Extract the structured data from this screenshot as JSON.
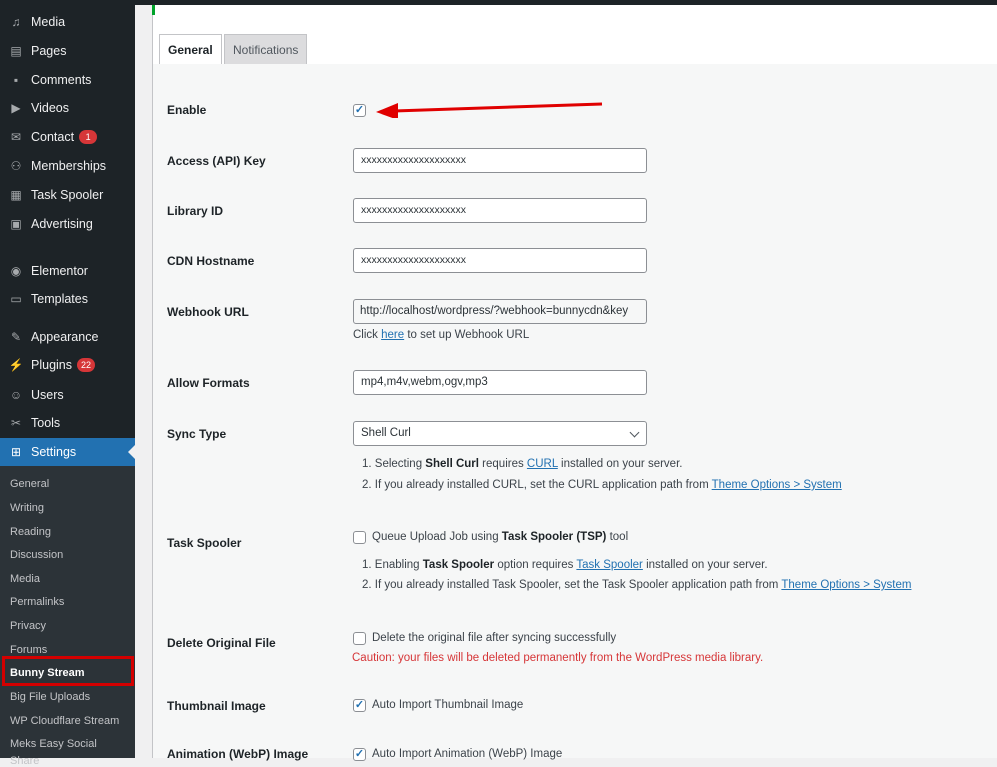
{
  "sidebar": {
    "menu": [
      {
        "label": "Media",
        "icon": "media-icon",
        "glyph": "♫"
      },
      {
        "label": "Pages",
        "icon": "pages-icon",
        "glyph": "▤"
      },
      {
        "label": "Comments",
        "icon": "comments-icon",
        "glyph": "▪"
      },
      {
        "label": "Videos",
        "icon": "videos-icon",
        "glyph": "▶"
      },
      {
        "label": "Contact",
        "icon": "contact-icon",
        "glyph": "✉",
        "badge": "1"
      },
      {
        "label": "Memberships",
        "icon": "memberships-icon",
        "glyph": "⚇"
      },
      {
        "label": "Task Spooler",
        "icon": "task-spooler-icon",
        "glyph": "▦"
      },
      {
        "label": "Advertising",
        "icon": "advertising-icon",
        "glyph": "▣"
      },
      {
        "label": "Elementor",
        "icon": "elementor-icon",
        "glyph": "◉"
      },
      {
        "label": "Templates",
        "icon": "templates-icon",
        "glyph": "▭"
      },
      {
        "label": "Appearance",
        "icon": "appearance-icon",
        "glyph": "✎"
      },
      {
        "label": "Plugins",
        "icon": "plugins-icon",
        "glyph": "⚡",
        "badge": "22"
      },
      {
        "label": "Users",
        "icon": "users-icon",
        "glyph": "☺"
      },
      {
        "label": "Tools",
        "icon": "tools-icon",
        "glyph": "✂"
      },
      {
        "label": "Settings",
        "icon": "settings-icon",
        "glyph": "⊞"
      }
    ],
    "submenu": [
      "General",
      "Writing",
      "Reading",
      "Discussion",
      "Media",
      "Permalinks",
      "Privacy",
      "Forums",
      "Bunny Stream",
      "Big File Uploads",
      "WP Cloudflare Stream",
      "Meks Easy Social",
      "Share"
    ]
  },
  "tabs": [
    "General",
    "Notifications"
  ],
  "form": {
    "enable": {
      "label": "Enable",
      "checked": true
    },
    "api_key": {
      "label": "Access (API) Key",
      "value": "xxxxxxxxxxxxxxxxxxxx"
    },
    "library_id": {
      "label": "Library ID",
      "value": "xxxxxxxxxxxxxxxxxxxx"
    },
    "cdn_hostname": {
      "label": "CDN Hostname",
      "value": "xxxxxxxxxxxxxxxxxxxx"
    },
    "webhook_url": {
      "label": "Webhook URL",
      "value": "http://localhost/wordpress/?webhook=bunnycdn&key",
      "hint_pre": "Click ",
      "hint_link": "here",
      "hint_post": " to set up Webhook URL"
    },
    "allow_formats": {
      "label": "Allow Formats",
      "value": "mp4,m4v,webm,ogv,mp3"
    },
    "sync_type": {
      "label": "Sync Type",
      "value": "Shell Curl",
      "note1_pre": "1. Selecting ",
      "note1_bold": "Shell Curl",
      "note1_mid": " requires ",
      "note1_link": "CURL",
      "note1_post": " installed on your server.",
      "note2_pre": "2. If you already installed CURL, set the CURL application path from ",
      "note2_link": "Theme Options > System"
    },
    "task_spooler": {
      "label": "Task Spooler",
      "check_pre": "Queue Upload Job using ",
      "check_bold": "Task Spooler (TSP)",
      "check_post": " tool",
      "note1_pre": "1. Enabling ",
      "note1_bold": "Task Spooler",
      "note1_mid": " option requires ",
      "note1_link": "Task Spooler",
      "note1_post": " installed on your server.",
      "note2_pre": "2. If you already installed Task Spooler, set the Task Spooler application path from ",
      "note2_link": "Theme Options > System"
    },
    "delete_original": {
      "label": "Delete Original File",
      "check": "Delete the original file after syncing successfully",
      "caution": "Caution: your files will be deleted permanently from the WordPress media library."
    },
    "thumbnail": {
      "label": "Thumbnail Image",
      "check": "Auto Import Thumbnail Image",
      "checked": true
    },
    "animation": {
      "label": "Animation (WebP) Image",
      "check": "Auto Import Animation (WebP) Image",
      "checked": true
    }
  },
  "colors": {
    "accent": "#2271b1",
    "sidebar_bg": "#1d2327",
    "annotation_red": "#d40000"
  }
}
